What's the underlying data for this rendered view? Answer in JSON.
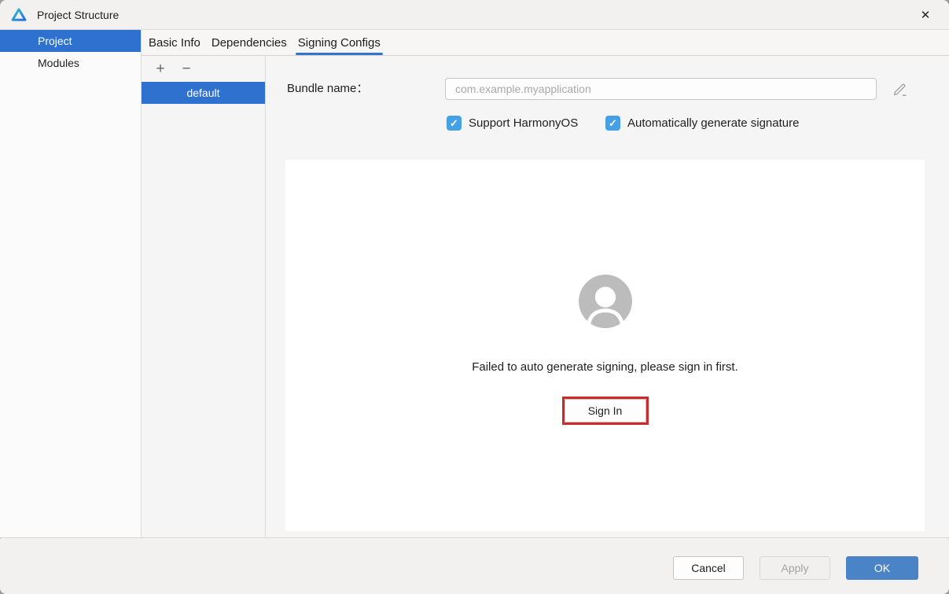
{
  "window": {
    "title": "Project Structure"
  },
  "icons": {
    "close": "✕",
    "add": "+",
    "remove": "−",
    "check": "✓"
  },
  "sidebar": {
    "items": [
      {
        "label": "Project",
        "selected": true
      },
      {
        "label": "Modules",
        "selected": false
      }
    ]
  },
  "tabs": [
    {
      "label": "Basic Info",
      "selected": false
    },
    {
      "label": "Dependencies",
      "selected": false
    },
    {
      "label": "Signing Configs",
      "selected": true
    }
  ],
  "config_list": {
    "items": [
      {
        "label": "default",
        "selected": true
      }
    ]
  },
  "form": {
    "bundle_name_label": "Bundle name：",
    "bundle_name_placeholder": "com.example.myapplication",
    "checkboxes": [
      {
        "label": "Support HarmonyOS",
        "checked": true
      },
      {
        "label": "Automatically generate signature",
        "checked": true
      }
    ]
  },
  "signing_panel": {
    "message": "Failed to auto generate signing, please sign in first.",
    "sign_in_label": "Sign In"
  },
  "footer": {
    "cancel_label": "Cancel",
    "apply_label": "Apply",
    "ok_label": "OK"
  },
  "colors": {
    "selection_blue": "#2e71cf",
    "tab_underline_blue": "#3274d2",
    "checkbox_blue": "#45a0e5",
    "ok_button_blue": "#4a83c6",
    "highlight_red": "#cb2a2e"
  }
}
